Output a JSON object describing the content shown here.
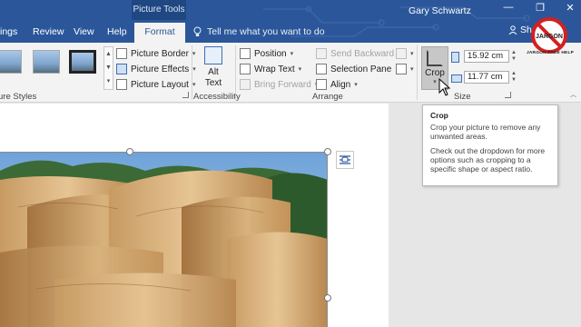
{
  "window": {
    "context_group": "Picture Tools",
    "user_name": "Gary Schwartz",
    "share_label": "Share",
    "minimize_glyph": "—",
    "restore_glyph": "❐",
    "close_glyph": "✕"
  },
  "tabs": [
    {
      "label": "ings"
    },
    {
      "label": "Review"
    },
    {
      "label": "View"
    },
    {
      "label": "Help"
    },
    {
      "label": "Format"
    }
  ],
  "tell_me": {
    "placeholder": "Tell me what you want to do"
  },
  "ribbon": {
    "picture_styles": {
      "group_label": "ure Styles",
      "border_label": "Picture Border",
      "effects_label": "Picture Effects",
      "layout_label": "Picture Layout"
    },
    "accessibility": {
      "alt_text_line1": "Alt",
      "alt_text_line2": "Text",
      "group_label": "Accessibility"
    },
    "arrange": {
      "position_label": "Position",
      "wrap_text_label": "Wrap Text",
      "bring_forward_label": "Bring Forward",
      "send_backward_label": "Send Backward",
      "selection_pane_label": "Selection Pane",
      "align_label": "Align",
      "group_label": "Arrange"
    },
    "size": {
      "crop_label": "Crop",
      "height_value": "15.92 cm",
      "width_value": "11.77 cm",
      "group_label": "Size"
    }
  },
  "tooltip": {
    "title": "Crop",
    "line1": "Crop your picture to remove any unwanted areas.",
    "line2": "Check out the dropdown for more options such as cropping to a specific shape or aspect ratio."
  },
  "logo": {
    "badge_text": "JARGON",
    "caption": "JARGON FREE HELP"
  },
  "icons": {
    "search": "lightbulb-icon",
    "share": "person-icon"
  },
  "colors": {
    "accent": "#2b579a",
    "ribbon": "#f3f3f3",
    "crop_pressed": "#c7c7c7",
    "logo_red": "#d42020"
  }
}
